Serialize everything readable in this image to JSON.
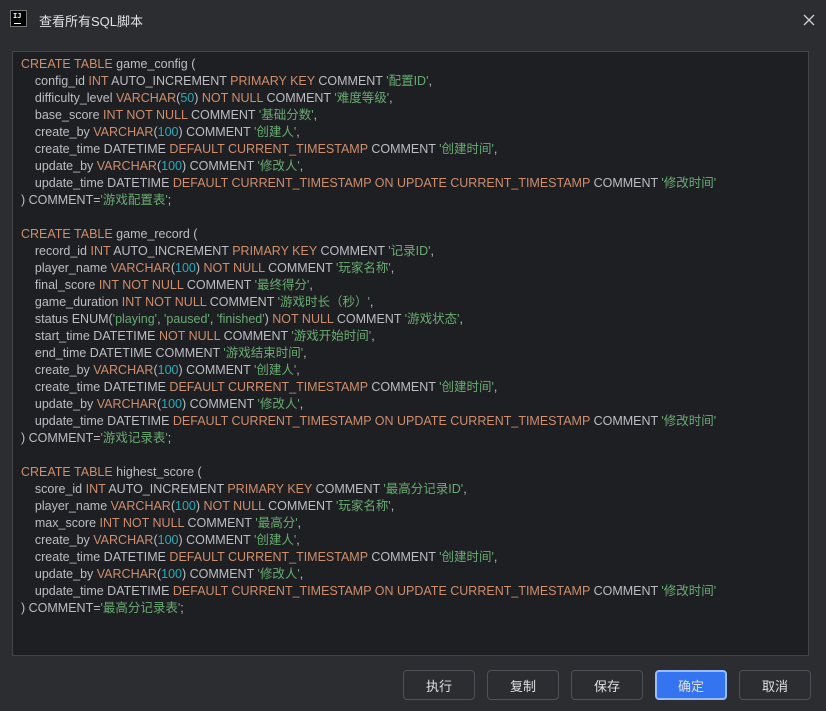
{
  "window": {
    "title": "查看所有SQL脚本",
    "app_icon_text": "IJ"
  },
  "editor": {
    "lines": [
      [
        {
          "t": "CREATE TABLE",
          "c": "kw"
        },
        {
          "t": " game_config (",
          "c": ""
        }
      ],
      [
        {
          "t": "    config_id ",
          "c": ""
        },
        {
          "t": "INT",
          "c": "kw"
        },
        {
          "t": " AUTO_INCREMENT ",
          "c": ""
        },
        {
          "t": "PRIMARY KEY",
          "c": "kw"
        },
        {
          "t": " COMMENT ",
          "c": ""
        },
        {
          "t": "'配置ID'",
          "c": "str"
        },
        {
          "t": ",",
          "c": ""
        }
      ],
      [
        {
          "t": "    difficulty_level ",
          "c": ""
        },
        {
          "t": "VARCHAR",
          "c": "kw"
        },
        {
          "t": "(",
          "c": ""
        },
        {
          "t": "50",
          "c": "num"
        },
        {
          "t": ") ",
          "c": ""
        },
        {
          "t": "NOT NULL",
          "c": "kw"
        },
        {
          "t": " COMMENT ",
          "c": ""
        },
        {
          "t": "'难度等级'",
          "c": "str"
        },
        {
          "t": ",",
          "c": ""
        }
      ],
      [
        {
          "t": "    base_score ",
          "c": ""
        },
        {
          "t": "INT NOT NULL",
          "c": "kw"
        },
        {
          "t": " COMMENT ",
          "c": ""
        },
        {
          "t": "'基础分数'",
          "c": "str"
        },
        {
          "t": ",",
          "c": ""
        }
      ],
      [
        {
          "t": "    create_by ",
          "c": ""
        },
        {
          "t": "VARCHAR",
          "c": "kw"
        },
        {
          "t": "(",
          "c": ""
        },
        {
          "t": "100",
          "c": "num"
        },
        {
          "t": ") COMMENT ",
          "c": ""
        },
        {
          "t": "'创建人'",
          "c": "str"
        },
        {
          "t": ",",
          "c": ""
        }
      ],
      [
        {
          "t": "    create_time DATETIME ",
          "c": ""
        },
        {
          "t": "DEFAULT CURRENT_TIMESTAMP",
          "c": "kw"
        },
        {
          "t": " COMMENT ",
          "c": ""
        },
        {
          "t": "'创建时间'",
          "c": "str"
        },
        {
          "t": ",",
          "c": ""
        }
      ],
      [
        {
          "t": "    update_by ",
          "c": ""
        },
        {
          "t": "VARCHAR",
          "c": "kw"
        },
        {
          "t": "(",
          "c": ""
        },
        {
          "t": "100",
          "c": "num"
        },
        {
          "t": ") COMMENT ",
          "c": ""
        },
        {
          "t": "'修改人'",
          "c": "str"
        },
        {
          "t": ",",
          "c": ""
        }
      ],
      [
        {
          "t": "    update_time DATETIME ",
          "c": ""
        },
        {
          "t": "DEFAULT CURRENT_TIMESTAMP ON UPDATE CURRENT_TIMESTAMP",
          "c": "kw"
        },
        {
          "t": " COMMENT ",
          "c": ""
        },
        {
          "t": "'修改时间'",
          "c": "str"
        }
      ],
      [
        {
          "t": ") COMMENT=",
          "c": ""
        },
        {
          "t": "'游戏配置表'",
          "c": "str"
        },
        {
          "t": ";",
          "c": ""
        }
      ],
      [],
      [
        {
          "t": "CREATE TABLE",
          "c": "kw"
        },
        {
          "t": " game_record (",
          "c": ""
        }
      ],
      [
        {
          "t": "    record_id ",
          "c": ""
        },
        {
          "t": "INT",
          "c": "kw"
        },
        {
          "t": " AUTO_INCREMENT ",
          "c": ""
        },
        {
          "t": "PRIMARY KEY",
          "c": "kw"
        },
        {
          "t": " COMMENT ",
          "c": ""
        },
        {
          "t": "'记录ID'",
          "c": "str"
        },
        {
          "t": ",",
          "c": ""
        }
      ],
      [
        {
          "t": "    player_name ",
          "c": ""
        },
        {
          "t": "VARCHAR",
          "c": "kw"
        },
        {
          "t": "(",
          "c": ""
        },
        {
          "t": "100",
          "c": "num"
        },
        {
          "t": ") ",
          "c": ""
        },
        {
          "t": "NOT NULL",
          "c": "kw"
        },
        {
          "t": " COMMENT ",
          "c": ""
        },
        {
          "t": "'玩家名称'",
          "c": "str"
        },
        {
          "t": ",",
          "c": ""
        }
      ],
      [
        {
          "t": "    final_score ",
          "c": ""
        },
        {
          "t": "INT NOT NULL",
          "c": "kw"
        },
        {
          "t": " COMMENT ",
          "c": ""
        },
        {
          "t": "'最终得分'",
          "c": "str"
        },
        {
          "t": ",",
          "c": ""
        }
      ],
      [
        {
          "t": "    game_duration ",
          "c": ""
        },
        {
          "t": "INT NOT NULL",
          "c": "kw"
        },
        {
          "t": " COMMENT ",
          "c": ""
        },
        {
          "t": "'游戏时长（秒）'",
          "c": "str"
        },
        {
          "t": ",",
          "c": ""
        }
      ],
      [
        {
          "t": "    status ENUM(",
          "c": ""
        },
        {
          "t": "'playing'",
          "c": "str"
        },
        {
          "t": ", ",
          "c": ""
        },
        {
          "t": "'paused'",
          "c": "str"
        },
        {
          "t": ", ",
          "c": ""
        },
        {
          "t": "'finished'",
          "c": "str"
        },
        {
          "t": ") ",
          "c": ""
        },
        {
          "t": "NOT NULL",
          "c": "kw"
        },
        {
          "t": " COMMENT ",
          "c": ""
        },
        {
          "t": "'游戏状态'",
          "c": "str"
        },
        {
          "t": ",",
          "c": ""
        }
      ],
      [
        {
          "t": "    start_time DATETIME ",
          "c": ""
        },
        {
          "t": "NOT NULL",
          "c": "kw"
        },
        {
          "t": " COMMENT ",
          "c": ""
        },
        {
          "t": "'游戏开始时间'",
          "c": "str"
        },
        {
          "t": ",",
          "c": ""
        }
      ],
      [
        {
          "t": "    end_time DATETIME COMMENT ",
          "c": ""
        },
        {
          "t": "'游戏结束时间'",
          "c": "str"
        },
        {
          "t": ",",
          "c": ""
        }
      ],
      [
        {
          "t": "    create_by ",
          "c": ""
        },
        {
          "t": "VARCHAR",
          "c": "kw"
        },
        {
          "t": "(",
          "c": ""
        },
        {
          "t": "100",
          "c": "num"
        },
        {
          "t": ") COMMENT ",
          "c": ""
        },
        {
          "t": "'创建人'",
          "c": "str"
        },
        {
          "t": ",",
          "c": ""
        }
      ],
      [
        {
          "t": "    create_time DATETIME ",
          "c": ""
        },
        {
          "t": "DEFAULT CURRENT_TIMESTAMP",
          "c": "kw"
        },
        {
          "t": " COMMENT ",
          "c": ""
        },
        {
          "t": "'创建时间'",
          "c": "str"
        },
        {
          "t": ",",
          "c": ""
        }
      ],
      [
        {
          "t": "    update_by ",
          "c": ""
        },
        {
          "t": "VARCHAR",
          "c": "kw"
        },
        {
          "t": "(",
          "c": ""
        },
        {
          "t": "100",
          "c": "num"
        },
        {
          "t": ") COMMENT ",
          "c": ""
        },
        {
          "t": "'修改人'",
          "c": "str"
        },
        {
          "t": ",",
          "c": ""
        }
      ],
      [
        {
          "t": "    update_time DATETIME ",
          "c": ""
        },
        {
          "t": "DEFAULT CURRENT_TIMESTAMP ON UPDATE CURRENT_TIMESTAMP",
          "c": "kw"
        },
        {
          "t": " COMMENT ",
          "c": ""
        },
        {
          "t": "'修改时间'",
          "c": "str"
        }
      ],
      [
        {
          "t": ") COMMENT=",
          "c": ""
        },
        {
          "t": "'游戏记录表'",
          "c": "str"
        },
        {
          "t": ";",
          "c": ""
        }
      ],
      [],
      [
        {
          "t": "CREATE TABLE",
          "c": "kw"
        },
        {
          "t": " highest_score (",
          "c": ""
        }
      ],
      [
        {
          "t": "    score_id ",
          "c": ""
        },
        {
          "t": "INT",
          "c": "kw"
        },
        {
          "t": " AUTO_INCREMENT ",
          "c": ""
        },
        {
          "t": "PRIMARY KEY",
          "c": "kw"
        },
        {
          "t": " COMMENT ",
          "c": ""
        },
        {
          "t": "'最高分记录ID'",
          "c": "str"
        },
        {
          "t": ",",
          "c": ""
        }
      ],
      [
        {
          "t": "    player_name ",
          "c": ""
        },
        {
          "t": "VARCHAR",
          "c": "kw"
        },
        {
          "t": "(",
          "c": ""
        },
        {
          "t": "100",
          "c": "num"
        },
        {
          "t": ") ",
          "c": ""
        },
        {
          "t": "NOT NULL",
          "c": "kw"
        },
        {
          "t": " COMMENT ",
          "c": ""
        },
        {
          "t": "'玩家名称'",
          "c": "str"
        },
        {
          "t": ",",
          "c": ""
        }
      ],
      [
        {
          "t": "    max_score ",
          "c": ""
        },
        {
          "t": "INT NOT NULL",
          "c": "kw"
        },
        {
          "t": " COMMENT ",
          "c": ""
        },
        {
          "t": "'最高分'",
          "c": "str"
        },
        {
          "t": ",",
          "c": ""
        }
      ],
      [
        {
          "t": "    create_by ",
          "c": ""
        },
        {
          "t": "VARCHAR",
          "c": "kw"
        },
        {
          "t": "(",
          "c": ""
        },
        {
          "t": "100",
          "c": "num"
        },
        {
          "t": ") COMMENT ",
          "c": ""
        },
        {
          "t": "'创建人'",
          "c": "str"
        },
        {
          "t": ",",
          "c": ""
        }
      ],
      [
        {
          "t": "    create_time DATETIME ",
          "c": ""
        },
        {
          "t": "DEFAULT CURRENT_TIMESTAMP",
          "c": "kw"
        },
        {
          "t": " COMMENT ",
          "c": ""
        },
        {
          "t": "'创建时间'",
          "c": "str"
        },
        {
          "t": ",",
          "c": ""
        }
      ],
      [
        {
          "t": "    update_by ",
          "c": ""
        },
        {
          "t": "VARCHAR",
          "c": "kw"
        },
        {
          "t": "(",
          "c": ""
        },
        {
          "t": "100",
          "c": "num"
        },
        {
          "t": ") COMMENT ",
          "c": ""
        },
        {
          "t": "'修改人'",
          "c": "str"
        },
        {
          "t": ",",
          "c": ""
        }
      ],
      [
        {
          "t": "    update_time DATETIME ",
          "c": ""
        },
        {
          "t": "DEFAULT CURRENT_TIMESTAMP ON UPDATE CURRENT_TIMESTAMP",
          "c": "kw"
        },
        {
          "t": " COMMENT ",
          "c": ""
        },
        {
          "t": "'修改时间'",
          "c": "str"
        }
      ],
      [
        {
          "t": ") COMMENT=",
          "c": ""
        },
        {
          "t": "'最高分记录表'",
          "c": "str"
        },
        {
          "t": ";",
          "c": ""
        }
      ]
    ]
  },
  "buttons": {
    "execute": "执行",
    "copy": "复制",
    "save": "保存",
    "ok": "确定",
    "cancel": "取消"
  },
  "colors": {
    "background": "#2b2d30",
    "editor_background": "#1e1f22",
    "keyword": "#cf8e6d",
    "number": "#2aacb8",
    "string": "#6aab73",
    "text": "#bcbec4",
    "primary_button": "#3574f0"
  },
  "icons": {
    "app": "intellij-app-icon",
    "close": "close-icon"
  }
}
